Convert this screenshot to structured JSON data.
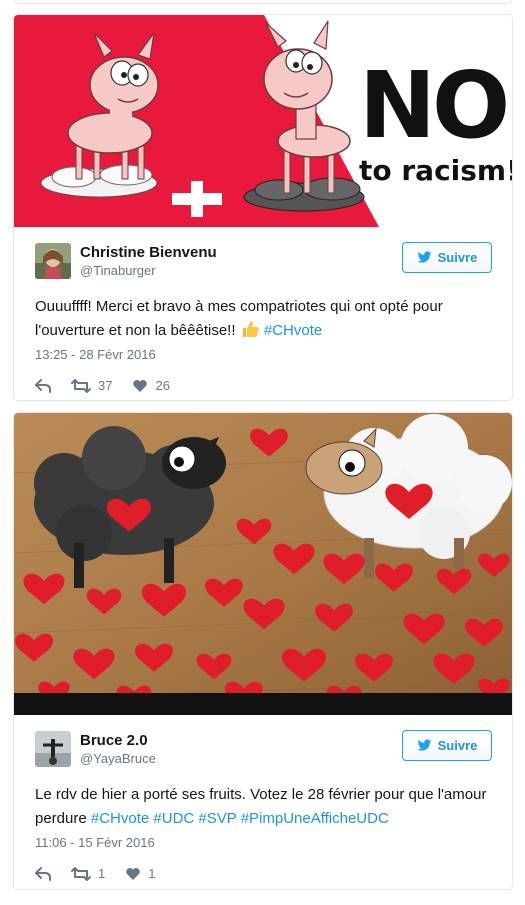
{
  "tweets": [
    {
      "media": {
        "no_text": "NO",
        "to_text": "to racism!"
      },
      "author": {
        "name": "Christine Bienvenu",
        "handle": "@Tinaburger"
      },
      "follow_label": "Suivre",
      "text": "Ouuuffff! Merci et bravo à mes compatriotes qui ont opté pour l'ouverture et non la bêêêtise!!",
      "emoji": "thumbs-up-emoji",
      "hashtags": [
        "#CHvote"
      ],
      "date": "13:25 - 28 Févr 2016",
      "retweets": "37",
      "likes": "26"
    },
    {
      "author": {
        "name": "Bruce 2.0",
        "handle": "@YayaBruce"
      },
      "follow_label": "Suivre",
      "text": "Le rdv de hier a porté ses fruits. Votez le 28 février pour que l'amour perdure",
      "hashtags": [
        "#CHvote",
        "#UDC",
        "#SVP",
        "#PimpUneAfficheUDC"
      ],
      "date": "11:06 - 15 Févr 2016",
      "retweets": "1",
      "likes": "1"
    }
  ],
  "colors": {
    "accent": "#1da1f2",
    "link": "#1b95e0",
    "muted": "#657786",
    "red_poster": "#e8193c"
  }
}
